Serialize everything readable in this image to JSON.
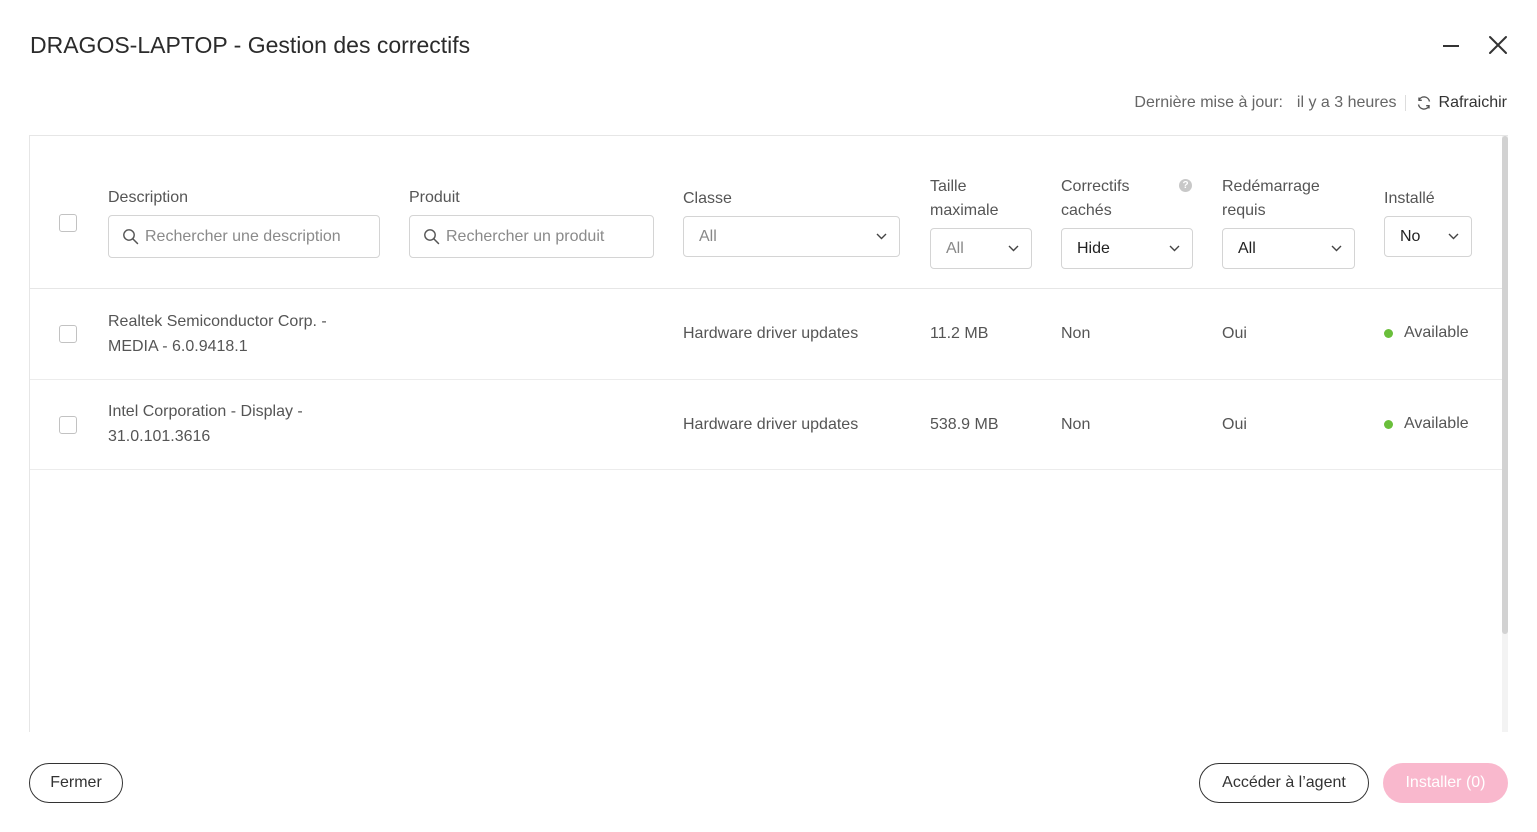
{
  "window": {
    "title": "DRAGOS-LAPTOP - Gestion des correctifs"
  },
  "toolbar": {
    "last_update_label": "Dernière mise à jour:",
    "last_update_value": "il y a 3 heures",
    "refresh_label": "Rafraichir"
  },
  "filters": {
    "description": {
      "label": "Description",
      "placeholder": "Rechercher une description"
    },
    "product": {
      "label": "Produit",
      "placeholder": "Rechercher un produit"
    },
    "class": {
      "label": "Classe",
      "value": "All"
    },
    "max_size": {
      "label_line1": "Taille",
      "label_line2": "maximale",
      "value": "All"
    },
    "hidden": {
      "label_line1": "Correctifs",
      "label_line2": "cachés",
      "value": "Hide"
    },
    "reboot": {
      "label_line1": "Redémarrage",
      "label_line2": "requis",
      "value": "All"
    },
    "installed": {
      "label": "Installé",
      "value": "No"
    }
  },
  "rows": [
    {
      "description_line1": "Realtek Semiconductor Corp. -",
      "description_line2": "MEDIA - 6.0.9418.1",
      "class": "Hardware driver updates",
      "size": "11.2 MB",
      "hidden": "Non",
      "reboot": "Oui",
      "status": "Available"
    },
    {
      "description_line1": "Intel Corporation - Display -",
      "description_line2": "31.0.101.3616",
      "class": "Hardware driver updates",
      "size": "538.9 MB",
      "hidden": "Non",
      "reboot": "Oui",
      "status": "Available"
    }
  ],
  "footer": {
    "close_label": "Fermer",
    "agent_label": "Accéder à l’agent",
    "install_label": "Installer (0)"
  },
  "colors": {
    "status_available": "#6abf3b",
    "primary_disabled": "#f9b8cd"
  }
}
